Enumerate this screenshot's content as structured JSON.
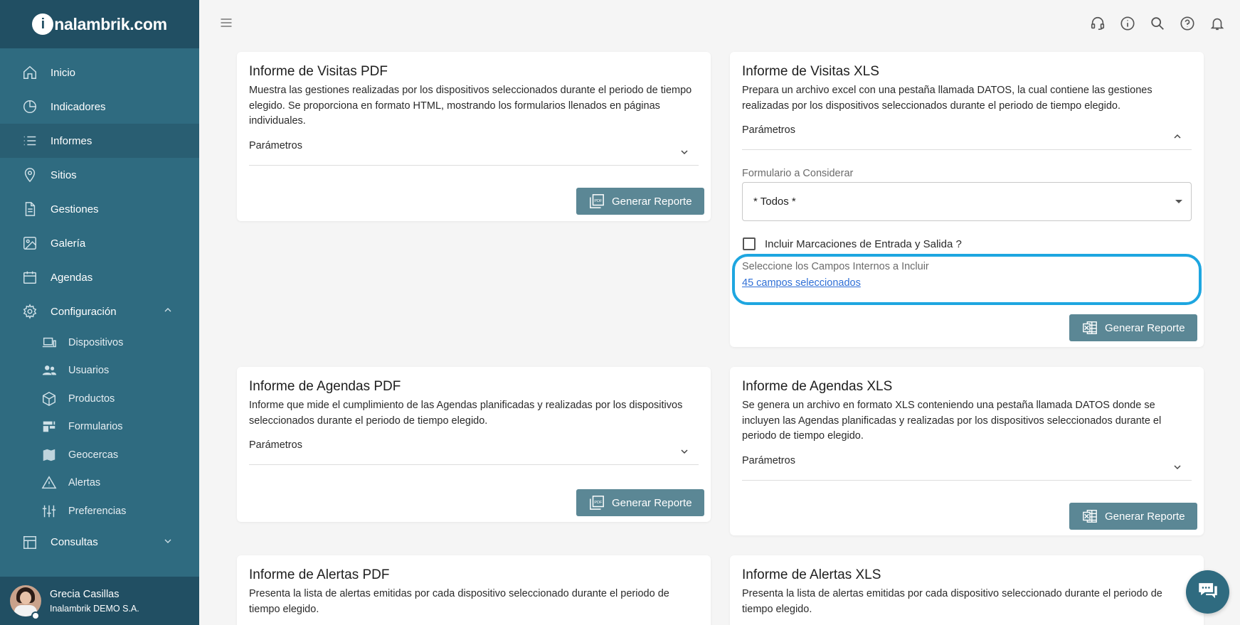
{
  "brand": {
    "logo_letter": "i",
    "logo_text": "nalambrik.com"
  },
  "sidebar": {
    "items": [
      {
        "label": "Inicio",
        "icon": "home-icon"
      },
      {
        "label": "Indicadores",
        "icon": "pie-chart-icon"
      },
      {
        "label": "Informes",
        "icon": "list-icon",
        "active": true
      },
      {
        "label": "Sitios",
        "icon": "location-pin-icon"
      },
      {
        "label": "Gestiones",
        "icon": "document-icon"
      },
      {
        "label": "Galería",
        "icon": "image-icon"
      },
      {
        "label": "Agendas",
        "icon": "calendar-icon"
      },
      {
        "label": "Configuración",
        "icon": "gear-icon",
        "expanded": true
      }
    ],
    "sub_items": [
      {
        "label": "Dispositivos",
        "icon": "devices-icon"
      },
      {
        "label": "Usuarios",
        "icon": "users-icon"
      },
      {
        "label": "Productos",
        "icon": "box-icon"
      },
      {
        "label": "Formularios",
        "icon": "form-icon"
      },
      {
        "label": "Geocercas",
        "icon": "map-icon"
      },
      {
        "label": "Alertas",
        "icon": "warning-icon"
      },
      {
        "label": "Preferencias",
        "icon": "sliders-icon"
      }
    ],
    "after_items": [
      {
        "label": "Consultas",
        "icon": "table-icon"
      }
    ]
  },
  "user": {
    "name": "Grecia Casillas",
    "org": "Inalambrik DEMO S.A."
  },
  "header": {
    "icons": [
      "support-agent-icon",
      "info-icon",
      "search-icon",
      "help-icon",
      "bell-icon"
    ]
  },
  "cards": {
    "visitas_pdf": {
      "title": "Informe de Visitas PDF",
      "desc": "Muestra las gestiones realizadas por los dispositivos seleccionados durante el periodo de tiempo elegido. Se proporciona en formato HTML, mostrando los formularios llenados en páginas individuales.",
      "params": "Parámetros",
      "button": "Generar Reporte"
    },
    "visitas_xls": {
      "title": "Informe de Visitas XLS",
      "desc": "Prepara un archivo excel con una pestaña llamada DATOS, la cual contiene las gestiones realizadas por los dispositivos seleccionados durante el periodo de tiempo elegido.",
      "params": "Parámetros",
      "form_label": "Formulario a Considerar",
      "form_value": "* Todos *",
      "checkbox_label": "Incluir Marcaciones de Entrada y Salida ?",
      "checkbox_checked": false,
      "fields_label": "Seleccione los Campos Internos a Incluir",
      "fields_link": "45 campos seleccionados",
      "button": "Generar Reporte"
    },
    "agendas_pdf": {
      "title": "Informe de Agendas PDF",
      "desc": "Informe que mide el cumplimiento de las Agendas planificadas y realizadas por los dispositivos seleccionados durante el periodo de tiempo elegido.",
      "params": "Parámetros",
      "button": "Generar Reporte"
    },
    "agendas_xls": {
      "title": "Informe de Agendas XLS",
      "desc": "Se genera un archivo en formato XLS conteniendo una pestaña llamada DATOS donde se incluyen las Agendas planificadas y realizadas por los dispositivos seleccionados durante el periodo de tiempo elegido.",
      "params": "Parámetros",
      "button": "Generar Reporte"
    },
    "alertas_pdf": {
      "title": "Informe de Alertas PDF",
      "desc": "Presenta la lista de alertas emitidas por cada dispositivo seleccionado durante el periodo de tiempo elegido."
    },
    "alertas_xls": {
      "title": "Informe de Alertas XLS",
      "desc": "Presenta la lista de alertas emitidas por cada dispositivo seleccionado durante el periodo de tiempo elegido."
    }
  },
  "colors": {
    "sidebar": "#2f6b80",
    "sidebar_dark": "#214f63",
    "button": "#5b8795",
    "highlight": "#1ea6e0",
    "link": "#2f6fd6"
  }
}
